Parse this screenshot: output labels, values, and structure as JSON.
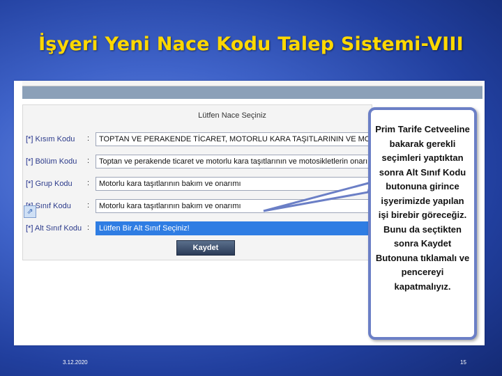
{
  "slide": {
    "title": "İşyeri Yeni Nace Kodu Talep Sistemi-VIII",
    "date": "3.12.2020",
    "page_number": "15"
  },
  "form": {
    "heading": "Lütfen Nace Seçiniz",
    "required_marker": "[*]",
    "colon": ":",
    "rows": [
      {
        "label": "Kısım Kodu",
        "value": "TOPTAN VE PERAKENDE TİCARET, MOTORLU KARA TAŞITLARININ VE MOTO"
      },
      {
        "label": "Bölüm Kodu",
        "value": "Toptan ve perakende ticaret ve motorlu kara taşıtlarının ve motosikletlerin onarımı"
      },
      {
        "label": "Grup Kodu",
        "value": "Motorlu kara taşıtlarının bakım ve onarımı"
      },
      {
        "label": "Sınıf Kodu",
        "value": "Motorlu kara taşıtlarının bakım ve onarımı"
      },
      {
        "label": "Alt Sınıf Kodu",
        "value": "Lütfen Bir Alt Sınıf Seçiniz!"
      }
    ],
    "save_label": "Kaydet"
  },
  "callout": {
    "text": "Prim Tarife Cetveeline bakarak gerekli seçimleri yaptıktan sonra Alt Sınıf Kodu butonuna girince işyerimizde yapılan işi birebir göreceğiz. Bunu da seçtikten sonra Kaydet Butonuna tıklamalı ve pencereyi kapatmalıyız."
  },
  "colors": {
    "title": "#ffd800",
    "selection": "#2f7de3",
    "callout_border": "#6b7fc6"
  }
}
